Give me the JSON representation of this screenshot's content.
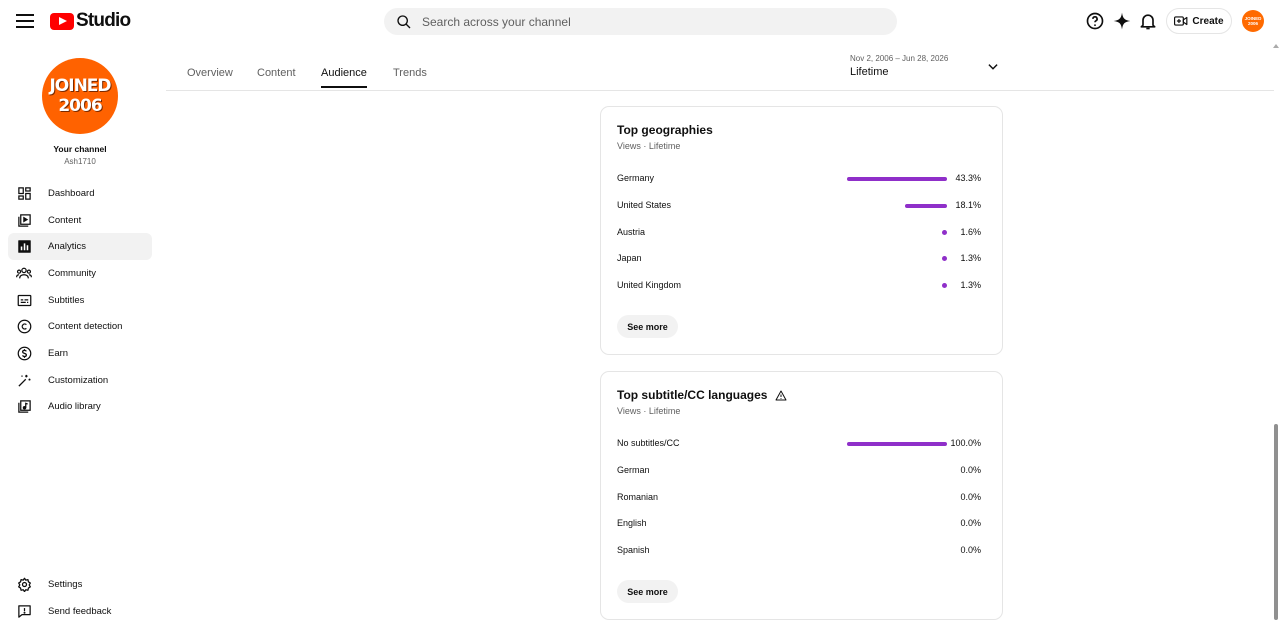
{
  "header": {
    "logo_text": "Studio",
    "search_placeholder": "Search across your channel",
    "create_label": "Create",
    "avatar_text": "JOINED 2006"
  },
  "sidebar": {
    "avatar_line1": "JOINED",
    "avatar_line2": "2006",
    "channel_label": "Your channel",
    "channel_handle": "Ash1710",
    "items": [
      {
        "label": "Dashboard",
        "icon": "dashboard-icon"
      },
      {
        "label": "Content",
        "icon": "content-icon"
      },
      {
        "label": "Analytics",
        "icon": "analytics-icon",
        "active": true
      },
      {
        "label": "Community",
        "icon": "community-icon"
      },
      {
        "label": "Subtitles",
        "icon": "subtitles-icon"
      },
      {
        "label": "Content detection",
        "icon": "copyright-icon"
      },
      {
        "label": "Earn",
        "icon": "dollar-icon"
      },
      {
        "label": "Customization",
        "icon": "magic-wand-icon"
      },
      {
        "label": "Audio library",
        "icon": "audio-library-icon"
      }
    ],
    "bottom_items": [
      {
        "label": "Settings",
        "icon": "gear-icon"
      },
      {
        "label": "Send feedback",
        "icon": "feedback-icon"
      }
    ]
  },
  "tabs": [
    {
      "label": "Overview"
    },
    {
      "label": "Content"
    },
    {
      "label": "Audience",
      "active": true
    },
    {
      "label": "Trends"
    }
  ],
  "date_picker": {
    "range": "Nov 2, 2006 – Jun 28, 2026",
    "period": "Lifetime"
  },
  "accent_color": "#8f2fc9",
  "cards": [
    {
      "title": "Top geographies",
      "subtitle": "Views · Lifetime",
      "see_more": "See more",
      "rows": [
        {
          "name": "Germany",
          "value": 43.3,
          "pct": "43.3%"
        },
        {
          "name": "United States",
          "value": 18.1,
          "pct": "18.1%"
        },
        {
          "name": "Austria",
          "value": 1.6,
          "pct": "1.6%"
        },
        {
          "name": "Japan",
          "value": 1.3,
          "pct": "1.3%"
        },
        {
          "name": "United Kingdom",
          "value": 1.3,
          "pct": "1.3%"
        }
      ]
    },
    {
      "title": "Top subtitle/CC languages",
      "subtitle": "Views · Lifetime",
      "see_more": "See more",
      "warning_icon": "warning-icon",
      "rows": [
        {
          "name": "No subtitles/CC",
          "value": 100.0,
          "pct": "100.0%"
        },
        {
          "name": "German",
          "value": 0.0,
          "pct": "0.0%"
        },
        {
          "name": "Romanian",
          "value": 0.0,
          "pct": "0.0%"
        },
        {
          "name": "English",
          "value": 0.0,
          "pct": "0.0%"
        },
        {
          "name": "Spanish",
          "value": 0.0,
          "pct": "0.0%"
        }
      ]
    }
  ]
}
